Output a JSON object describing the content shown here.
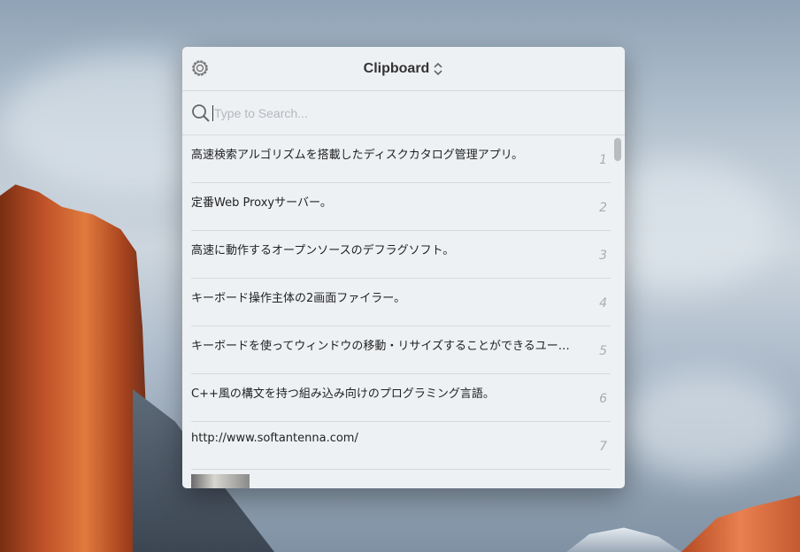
{
  "app": {
    "title": "Clipboard",
    "icons": {
      "settings": "gear-icon",
      "switcher": "chevron-up-down-icon",
      "search": "search-icon"
    }
  },
  "search": {
    "placeholder": "Type to Search...",
    "value": ""
  },
  "items": [
    {
      "text": "高速検索アルゴリズムを搭載したディスクカタログ管理アプリ。",
      "index": "1"
    },
    {
      "text": "定番Web Proxyサーバー。",
      "index": "2"
    },
    {
      "text": "高速に動作するオープンソースのデフラグソフト。",
      "index": "3"
    },
    {
      "text": "キーボード操作主体の2画面ファイラー。",
      "index": "4"
    },
    {
      "text": "キーボードを使ってウィンドウの移動・リサイズすることができるユーテ…",
      "index": "5"
    },
    {
      "text": "C++風の構文を持つ組み込み向けのプログラミング言語。",
      "index": "6"
    },
    {
      "text": "http://www.softantenna.com/",
      "index": "7"
    }
  ]
}
